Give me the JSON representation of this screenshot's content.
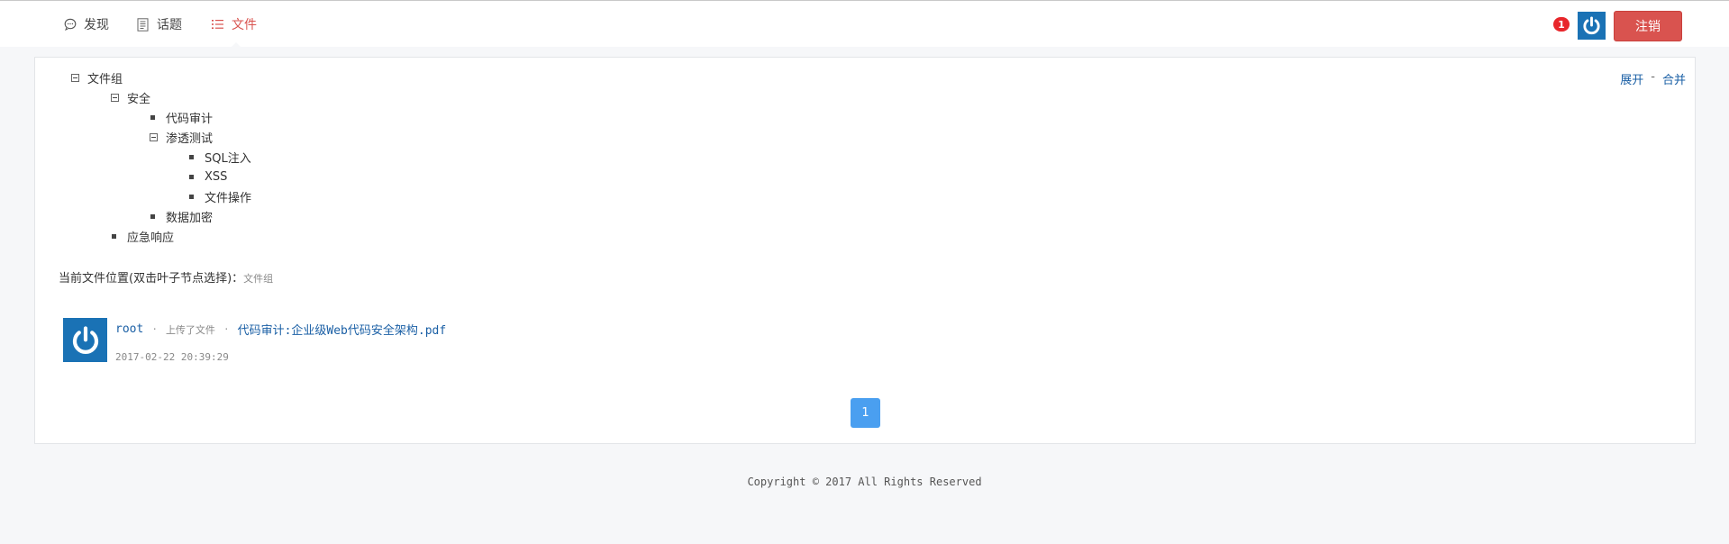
{
  "nav": {
    "items": [
      {
        "label": "发现",
        "icon": "chat-bubble-icon"
      },
      {
        "label": "话题",
        "icon": "document-icon"
      },
      {
        "label": "文件",
        "icon": "list-icon",
        "active": true
      }
    ]
  },
  "header": {
    "notification_count": "1",
    "logout_label": "注销"
  },
  "tree": {
    "expand_label": "展开",
    "separator": "-",
    "collapse_label": "合并",
    "nodes": [
      {
        "label": "文件组",
        "level": 0,
        "type": "folder"
      },
      {
        "label": "安全",
        "level": 1,
        "type": "folder"
      },
      {
        "label": "代码审计",
        "level": 2,
        "type": "leaf"
      },
      {
        "label": "渗透测试",
        "level": 2,
        "type": "folder"
      },
      {
        "label": "SQL注入",
        "level": 3,
        "type": "leaf"
      },
      {
        "label": "XSS",
        "level": 3,
        "type": "leaf"
      },
      {
        "label": "文件操作",
        "level": 3,
        "type": "leaf"
      },
      {
        "label": "数据加密",
        "level": 2,
        "type": "leaf"
      },
      {
        "label": "应急响应",
        "level": 1,
        "type": "leaf"
      }
    ]
  },
  "location": {
    "label": "当前文件位置(双击叶子节点选择)：",
    "path": "文件组"
  },
  "post": {
    "user": "root",
    "dot": "·",
    "action": "上传了文件",
    "file": "代码审计:企业级Web代码安全架构.pdf",
    "time": "2017-02-22 20:39:29"
  },
  "pagination": {
    "current": "1"
  },
  "footer": {
    "copyright": "Copyright © 2017 All Rights Reserved"
  },
  "colors": {
    "accent_red": "#d9534f",
    "link_blue": "#1a5fa5",
    "avatar_blue": "#1a72b5",
    "page_blue": "#4a9ff0"
  }
}
